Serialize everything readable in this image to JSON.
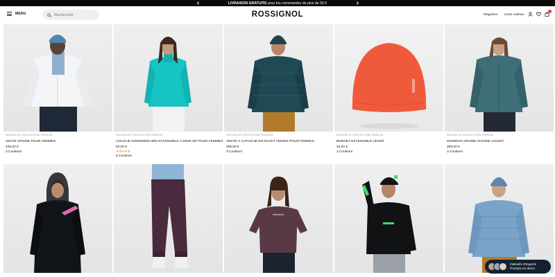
{
  "promo": {
    "text_prefix": "LIVRAISON GRATUITE",
    "text_rest": " pour les commandes de plus de 50 €"
  },
  "header": {
    "menu_label": "MENU",
    "search_placeholder": "Rechercher",
    "logo": "ROSSIGNOL",
    "links": [
      "Magasins",
      "Carte cadeau"
    ],
    "cart_count": "0"
  },
  "products_row1": [
    {
      "collection": "NOUVELLE COLLECTION FW24/25",
      "name": "VESTE OPSIDE POUR FEMMES",
      "price": "245,00 €",
      "colors": "3 Couleurs",
      "stars": ""
    },
    {
      "collection": "NOUVELLE COLLECTION FW24/25",
      "name": "COUCHE INTERMÉDIAIRE EXTENSIBLE À DEMI-ZIP POUR FEMMES",
      "price": "80,00 €",
      "colors": "6 Couleurs",
      "stars": "★★★★★"
    },
    {
      "collection": "NOUVELLE COLLECTION FW24/25",
      "name": "VESTE À CAPUCHE EN DUVET VERDIX POUR FEMMES",
      "price": "285,00 €",
      "colors": "3 Couleurs",
      "stars": ""
    },
    {
      "collection": "NOUVELLE COLLECTION FW24/25",
      "name": "BONNET EXTENSIBLE LÉGER",
      "price": "32,00 €",
      "colors": "3 Couleurs",
      "stars": ""
    },
    {
      "collection": "NOUVELLE COLLECTION FW24/25",
      "name": "WOMEN'S OPSIDE HOODIE JACKET",
      "price": "265,00 €",
      "colors": "3 Couleurs",
      "stars": ""
    }
  ],
  "chat": {
    "line1": "Conseils d'Experts",
    "line2": "Produits en direct"
  },
  "colors": {
    "teal": "#16c4c4",
    "navy": "#1f4a55",
    "orange": "#f05a3c",
    "slate": "#3e6f78",
    "star": "#e0a21b"
  }
}
